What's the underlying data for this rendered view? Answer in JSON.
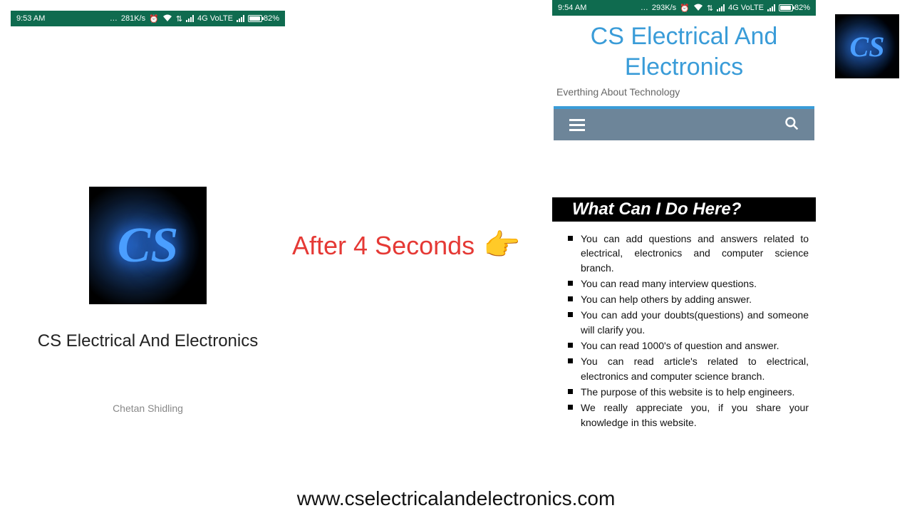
{
  "left_phone": {
    "status": {
      "time": "9:53 AM",
      "speed": "281K/s",
      "network": "4G VoLTE",
      "battery": "82%"
    },
    "splash": {
      "logo_text": "CS",
      "title": "CS Electrical And Electronics",
      "author": "Chetan Shidling"
    }
  },
  "right_phone": {
    "status": {
      "time": "9:54 AM",
      "speed": "293K/s",
      "network": "4G VoLTE",
      "battery": "82%"
    },
    "header": {
      "title": "CS Electrical And Electronics",
      "tagline": "Everthing About Technology"
    },
    "section_heading": "What Can I Do Here?",
    "bullets": [
      "You can add questions and answers related to electrical, electronics and computer science branch.",
      "You can read many interview questions.",
      "You can help others by adding answer.",
      "You can add your doubts(questions) and someone will clarify you.",
      "You can read 1000's of question and answer.",
      "You can read article's related to electrical, electronics and computer science branch.",
      "The purpose of this website is to help engineers.",
      "We really appreciate you, if you share your knowledge in this website."
    ]
  },
  "annotation": {
    "text": "After 4 Seconds",
    "emoji": "👉"
  },
  "footer_url": "www.cselectricalandelectronics.com",
  "small_logo_text": "CS"
}
